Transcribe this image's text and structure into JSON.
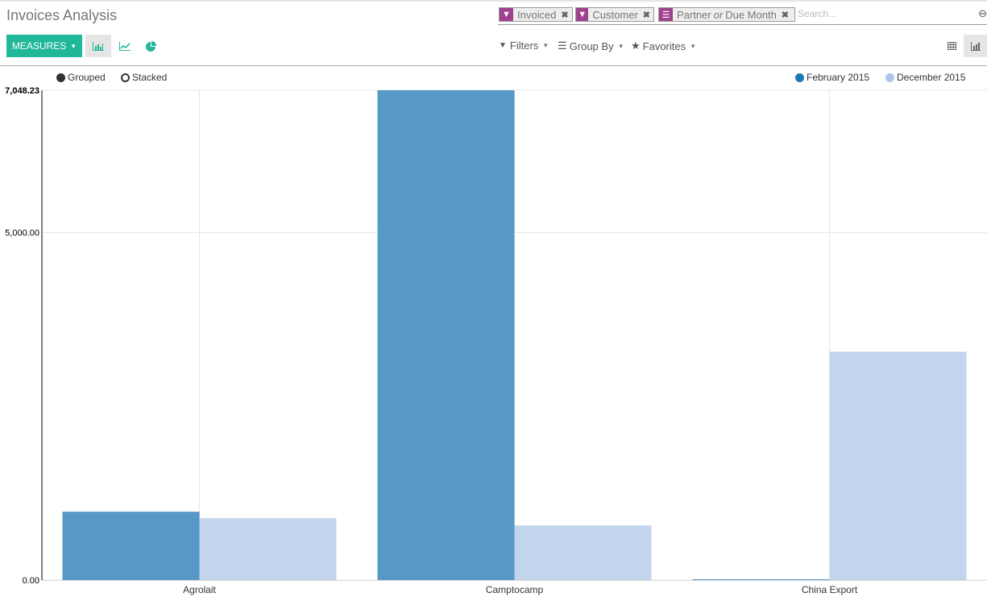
{
  "header": {
    "title": "Invoices Analysis",
    "facets": [
      {
        "icon": "filter-icon",
        "label": "Invoiced"
      },
      {
        "icon": "filter-icon",
        "label": "Customer"
      },
      {
        "icon": "group-by-icon",
        "label_a": "Partner",
        "label_or": "or",
        "label_b": "Due Month"
      }
    ],
    "search_placeholder": "Search..."
  },
  "toolbar": {
    "measures_label": "MEASURES",
    "filters_label": "Filters",
    "group_by_label": "Group By",
    "favorites_label": "Favorites"
  },
  "mode": {
    "grouped_label": "Grouped",
    "stacked_label": "Stacked",
    "selected": "Grouped"
  },
  "chart_data": {
    "type": "bar",
    "title": "",
    "xlabel": "",
    "ylabel": "",
    "categories": [
      "Agrolait",
      "Camptocamp",
      "China Export"
    ],
    "series": [
      {
        "name": "February 2015",
        "color": "#1f77b4",
        "bar_color": "#5799c6",
        "values": [
          984,
          7048.23,
          12
        ]
      },
      {
        "name": "December 2015",
        "color": "#aec7e8",
        "bar_color": "#c3d5ec",
        "values": [
          891,
          787,
          3287
        ]
      }
    ],
    "ylim": [
      0,
      7048.23
    ],
    "yticks": [
      0,
      5000,
      7048.23
    ],
    "ytick_labels": [
      "0.00",
      "5,000.00",
      "7,048.23"
    ],
    "grid": true,
    "legend": "top-right"
  }
}
